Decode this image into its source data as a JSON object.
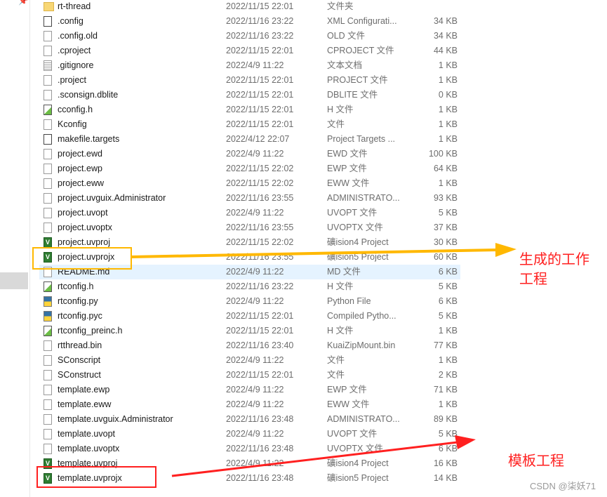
{
  "files": [
    {
      "name": "rt-thread",
      "date": "2022/11/15 22:01",
      "type": "文件夹",
      "size": "",
      "icon": "folder"
    },
    {
      "name": ".config",
      "date": "2022/11/16 23:22",
      "type": "XML Configurati...",
      "size": "34 KB",
      "icon": "cfg"
    },
    {
      "name": ".config.old",
      "date": "2022/11/16 23:22",
      "type": "OLD 文件",
      "size": "34 KB",
      "icon": "file"
    },
    {
      "name": ".cproject",
      "date": "2022/11/15 22:01",
      "type": "CPROJECT 文件",
      "size": "44 KB",
      "icon": "file"
    },
    {
      "name": ".gitignore",
      "date": "2022/4/9 11:22",
      "type": "文本文档",
      "size": "1 KB",
      "icon": "txt"
    },
    {
      "name": ".project",
      "date": "2022/11/15 22:01",
      "type": "PROJECT 文件",
      "size": "1 KB",
      "icon": "file"
    },
    {
      "name": ".sconsign.dblite",
      "date": "2022/11/15 22:01",
      "type": "DBLITE 文件",
      "size": "0 KB",
      "icon": "file"
    },
    {
      "name": "cconfig.h",
      "date": "2022/11/15 22:01",
      "type": "H 文件",
      "size": "1 KB",
      "icon": "h"
    },
    {
      "name": "Kconfig",
      "date": "2022/11/15 22:01",
      "type": "文件",
      "size": "1 KB",
      "icon": "file"
    },
    {
      "name": "makefile.targets",
      "date": "2022/4/12 22:07",
      "type": "Project Targets ...",
      "size": "1 KB",
      "icon": "cfg"
    },
    {
      "name": "project.ewd",
      "date": "2022/4/9 11:22",
      "type": "EWD 文件",
      "size": "100 KB",
      "icon": "file"
    },
    {
      "name": "project.ewp",
      "date": "2022/11/15 22:02",
      "type": "EWP 文件",
      "size": "64 KB",
      "icon": "file"
    },
    {
      "name": "project.eww",
      "date": "2022/11/15 22:02",
      "type": "EWW 文件",
      "size": "1 KB",
      "icon": "file"
    },
    {
      "name": "project.uvguix.Administrator",
      "date": "2022/11/16 23:55",
      "type": "ADMINISTRATO...",
      "size": "93 KB",
      "icon": "file"
    },
    {
      "name": "project.uvopt",
      "date": "2022/4/9 11:22",
      "type": "UVOPT 文件",
      "size": "5 KB",
      "icon": "file"
    },
    {
      "name": "project.uvoptx",
      "date": "2022/11/16 23:55",
      "type": "UVOPTX 文件",
      "size": "37 KB",
      "icon": "file"
    },
    {
      "name": "project.uvproj",
      "date": "2022/11/15 22:02",
      "type": "礦ision4 Project",
      "size": "30 KB",
      "icon": "uv"
    },
    {
      "name": "project.uvprojx",
      "date": "2022/11/16 23:55",
      "type": "礦ision5 Project",
      "size": "60 KB",
      "icon": "uv"
    },
    {
      "name": "README.md",
      "date": "2022/4/9 11:22",
      "type": "MD 文件",
      "size": "6 KB",
      "icon": "file",
      "selected": true
    },
    {
      "name": "rtconfig.h",
      "date": "2022/11/16 23:22",
      "type": "H 文件",
      "size": "5 KB",
      "icon": "h"
    },
    {
      "name": "rtconfig.py",
      "date": "2022/4/9 11:22",
      "type": "Python File",
      "size": "6 KB",
      "icon": "py"
    },
    {
      "name": "rtconfig.pyc",
      "date": "2022/11/15 22:01",
      "type": "Compiled Pytho...",
      "size": "5 KB",
      "icon": "py"
    },
    {
      "name": "rtconfig_preinc.h",
      "date": "2022/11/15 22:01",
      "type": "H 文件",
      "size": "1 KB",
      "icon": "h"
    },
    {
      "name": "rtthread.bin",
      "date": "2022/11/16 23:40",
      "type": "KuaiZipMount.bin",
      "size": "77 KB",
      "icon": "file"
    },
    {
      "name": "SConscript",
      "date": "2022/4/9 11:22",
      "type": "文件",
      "size": "1 KB",
      "icon": "file"
    },
    {
      "name": "SConstruct",
      "date": "2022/11/15 22:01",
      "type": "文件",
      "size": "2 KB",
      "icon": "file"
    },
    {
      "name": "template.ewp",
      "date": "2022/4/9 11:22",
      "type": "EWP 文件",
      "size": "71 KB",
      "icon": "file"
    },
    {
      "name": "template.eww",
      "date": "2022/4/9 11:22",
      "type": "EWW 文件",
      "size": "1 KB",
      "icon": "file"
    },
    {
      "name": "template.uvguix.Administrator",
      "date": "2022/11/16 23:48",
      "type": "ADMINISTRATO...",
      "size": "89 KB",
      "icon": "file"
    },
    {
      "name": "template.uvopt",
      "date": "2022/4/9 11:22",
      "type": "UVOPT 文件",
      "size": "5 KB",
      "icon": "file"
    },
    {
      "name": "template.uvoptx",
      "date": "2022/11/16 23:48",
      "type": "UVOPTX 文件",
      "size": "6 KB",
      "icon": "file"
    },
    {
      "name": "template.uvproj",
      "date": "2022/4/9 11:22",
      "type": "礦ision4 Project",
      "size": "16 KB",
      "icon": "uv"
    },
    {
      "name": "template.uvprojx",
      "date": "2022/11/16 23:48",
      "type": "礦ision5 Project",
      "size": "14 KB",
      "icon": "uv"
    }
  ],
  "annotations": {
    "generated_line1": "生成的工作",
    "generated_line2": "工程",
    "template": "模板工程",
    "yellow": "#ffb800",
    "red": "#ff2020"
  },
  "watermark": "CSDN @柒妖71"
}
